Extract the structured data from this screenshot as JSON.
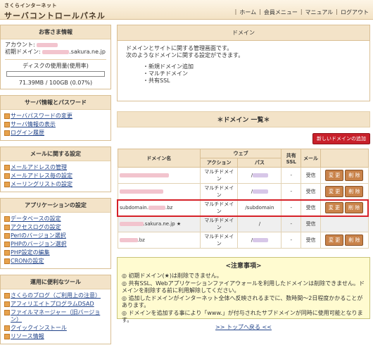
{
  "header": {
    "logo_small": "さくらインターネット",
    "logo_big": "サーバコントロールパネル",
    "nav": [
      "ホーム",
      "会員メニュー",
      "マニュアル",
      "ログアウト"
    ]
  },
  "sidebar": {
    "customer": {
      "title": "お客さま情報",
      "account_label": "アカウント:",
      "domain_label": "初期ドメイン:",
      "domain_suffix": ".sakura.ne.jp",
      "disk_label": "ディスクの使用量(使用率)",
      "disk_value": "71.39MB / 100GB (0.07%)",
      "disk_fraction": 0.0007
    },
    "server": {
      "title": "サーバ情報とパスワード",
      "items": [
        "サーバパスワードの変更",
        "サーバ情報の表示",
        "ログイン履歴"
      ]
    },
    "mail": {
      "title": "メールに関する設定",
      "items": [
        "メールアドレスの管理",
        "メールアドレス毎の設定",
        "メーリングリストの設定"
      ]
    },
    "apps": {
      "title": "アプリケーションの設定",
      "items": [
        "データベースの設定",
        "アクセスログの設定",
        "Perlのバージョン選択",
        "PHPのバージョン選択",
        "PHP設定の編集",
        "CRONの設定"
      ]
    },
    "tools": {
      "title": "運用に便利なツール",
      "items": [
        "さくらのブログ（ご利用上の注意）",
        "アフィリエイトプログラムDSAD",
        "ファイルマネージャー（旧バージョン）",
        "クイックインストール",
        "リソース情報"
      ]
    }
  },
  "main": {
    "title": "ドメイン",
    "intro_lines": [
      "ドメインとサイトに関する管理画面です。",
      "次のようなドメインに関する設定ができます。"
    ],
    "intro_items": [
      "・新規ドメイン追加",
      "・マルチドメイン",
      "・共有SSL"
    ],
    "list_title": "＊ドメイン 一覧＊",
    "new_button": "新しいドメインの追加",
    "table": {
      "headers": {
        "name": "ドメイン名",
        "web": "ウェブ",
        "action": "アクション",
        "path": "パス",
        "ssl": "共有SSL",
        "mail": "メール"
      },
      "rows": [
        {
          "name": "",
          "action": "マルチドメイン",
          "path": "/",
          "ssl": "-",
          "mail": "受信"
        },
        {
          "name": "",
          "action": "マルチドメイン",
          "path": "/",
          "ssl": "-",
          "mail": "受信"
        },
        {
          "name": "subdomain.",
          "name_suffix": ".bz",
          "action": "マルチドメイン",
          "path": "/subdomain",
          "ssl": "-",
          "mail": "受信"
        },
        {
          "name": ".sakura.ne.jp ★",
          "action": "マルチドメイン",
          "path": "/",
          "ssl": "-",
          "mail": "受信"
        },
        {
          "name": ".bz",
          "action": "マルチドメイン",
          "path": "/",
          "ssl": "-",
          "mail": "受信"
        }
      ],
      "edit_label": "変 更",
      "delete_label": "削 除"
    },
    "notes": {
      "title": "<注意事項>",
      "items": [
        "初期ドメイン(★)は削除できません。",
        "共有SSL、Webアプリケーションファイアウォールを利用したドメインは削除できません。ドメインを削除する前に利用解除してください。",
        "追加したドメインがインターネット全体へ反映されるまでに、数時間〜2日程度かかることがあります。",
        "ドメインを追加する事により「www.」が付与されたサブドメインが同時に使用可能となります。"
      ]
    },
    "footer_link": ">> トップへ戻る <<"
  }
}
